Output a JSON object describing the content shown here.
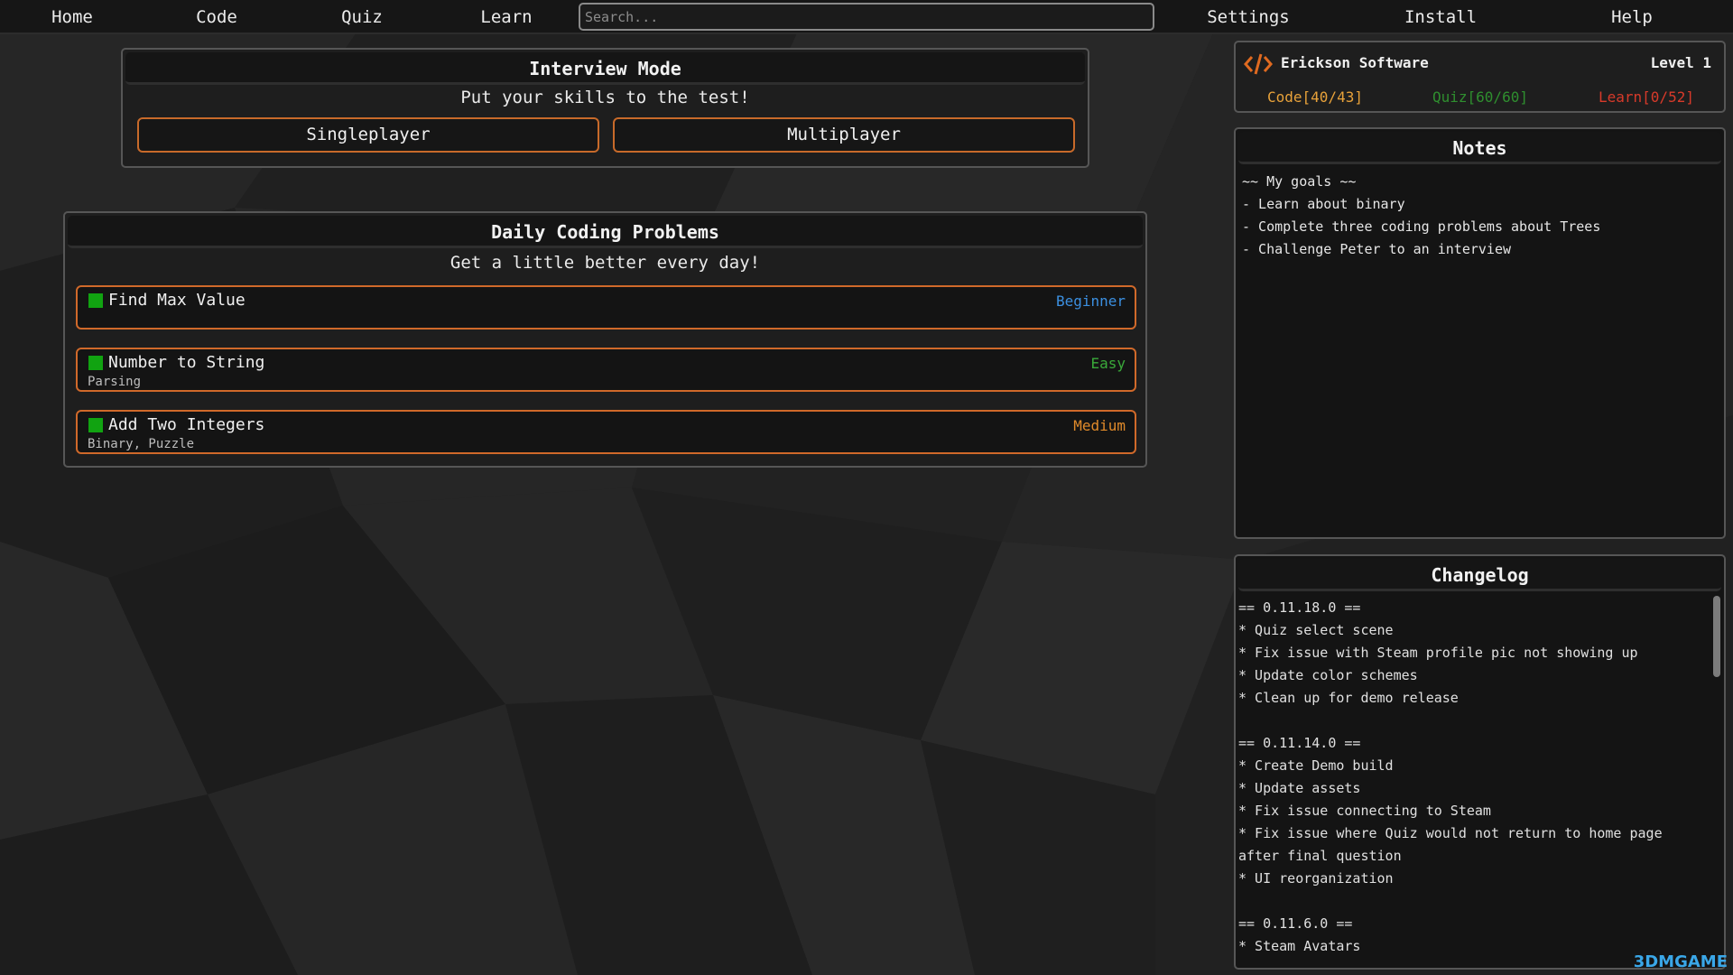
{
  "nav": {
    "items": [
      "Home",
      "Code",
      "Quiz",
      "Learn"
    ],
    "right_items": [
      "Settings",
      "Install",
      "Help"
    ],
    "search_placeholder": "Search..."
  },
  "interview": {
    "title": "Interview Mode",
    "subtitle": "Put your skills to the test!",
    "singleplayer": "Singleplayer",
    "multiplayer": "Multiplayer"
  },
  "daily": {
    "title": "Daily Coding Problems",
    "subtitle": "Get a little better every day!",
    "problems": [
      {
        "title": "Find Max Value",
        "tags": "",
        "difficulty": "Beginner",
        "color": "#3b8fe0"
      },
      {
        "title": "Number to String",
        "tags": "Parsing",
        "difficulty": "Easy",
        "color": "#3aa93a"
      },
      {
        "title": "Add Two Integers",
        "tags": "Binary, Puzzle",
        "difficulty": "Medium",
        "color": "#e08a2a"
      }
    ]
  },
  "profile": {
    "name": "Erickson Software",
    "level": "Level 1",
    "code": "Code[40/43]",
    "quiz": "Quiz[60/60]",
    "learn": "Learn[0/52]",
    "colors": {
      "code": "#e8a23a",
      "quiz": "#2f8f2f",
      "learn": "#d83a2a",
      "accent": "#e06a20"
    }
  },
  "notes": {
    "title": "Notes",
    "lines": [
      "~~ My goals ~~",
      "- Learn about binary",
      "- Complete three coding problems about Trees",
      "- Challenge Peter to an interview"
    ]
  },
  "changelog": {
    "title": "Changelog",
    "text": "== 0.11.18.0 ==\n* Quiz select scene\n* Fix issue with Steam profile pic not showing up\n* Update color schemes\n* Clean up for demo release\n\n== 0.11.14.0 ==\n* Create Demo build\n* Update assets\n* Fix issue connecting to Steam\n* Fix issue where Quiz would not return to home page after final question\n* UI reorganization\n\n== 0.11.6.0 ==\n* Steam Avatars"
  },
  "watermark": "3DMGAME"
}
